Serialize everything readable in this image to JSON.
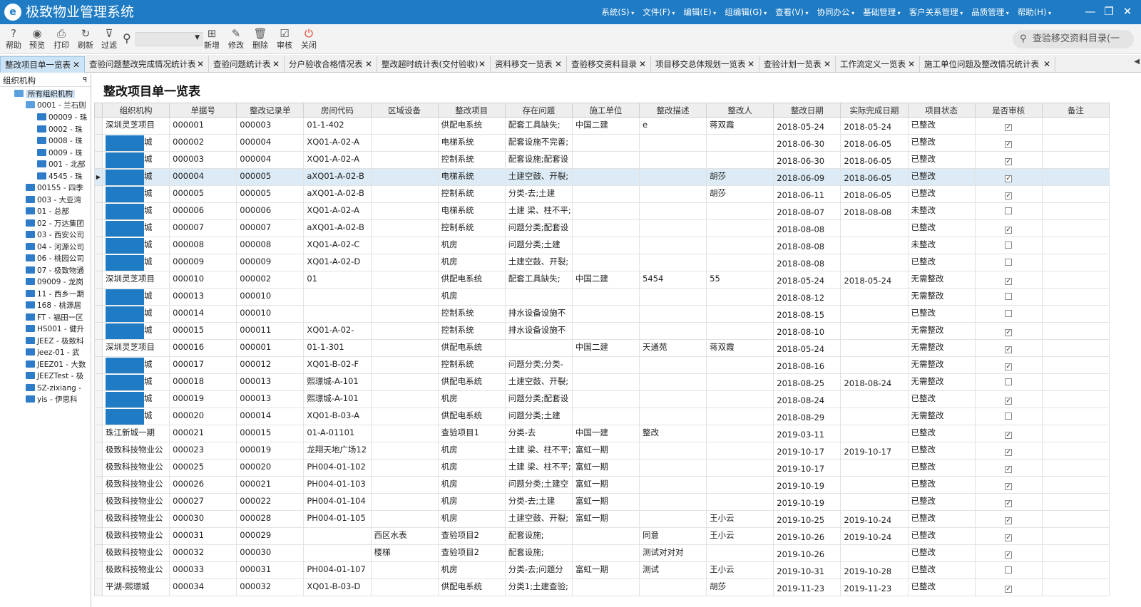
{
  "app": {
    "logo_glyph": "e",
    "title": "极致物业管理系统",
    "menu": [
      "系统(S)",
      "文件(F)",
      "编辑(E)",
      "组编辑(G)",
      "查看(V)",
      "协同办公",
      "基础管理",
      "客户关系管理",
      "品质管理",
      "帮助(H)"
    ],
    "window_controls": [
      "—",
      "❐",
      "✕"
    ]
  },
  "toolbar": {
    "buttons": [
      {
        "label": "帮助",
        "icon": "?"
      },
      {
        "label": "预览",
        "icon": "◉"
      },
      {
        "label": "打印",
        "icon": "⎙"
      },
      {
        "label": "刷新",
        "icon": "↻"
      },
      {
        "label": "过滤",
        "icon": "⊽"
      },
      {
        "label": "新增",
        "icon": "⊞"
      },
      {
        "label": "修改",
        "icon": "✎"
      },
      {
        "label": "删除",
        "icon": "🗑"
      },
      {
        "label": "审核",
        "icon": "☑"
      },
      {
        "label": "关闭",
        "icon": "⏻"
      }
    ],
    "search_icon": "⚲",
    "combo_value": "",
    "right_search_text": "查验移交资料目录(一"
  },
  "tabs": [
    {
      "label": "整改项目单一览表",
      "active": true
    },
    {
      "label": "查验问题整改完成情况统计表"
    },
    {
      "label": "查验问题统计表"
    },
    {
      "label": "分户验收合格情况表"
    },
    {
      "label": "整改超时统计表(交付验收)"
    },
    {
      "label": "资料移交一览表"
    },
    {
      "label": "查验移交资料目录"
    },
    {
      "label": "项目移交总体规划一览表"
    },
    {
      "label": "查验计划一览表"
    },
    {
      "label": "工作流定义一览表"
    },
    {
      "label": "施工单位问题及整改情况统计表"
    }
  ],
  "sidebar": {
    "title": "组织机构",
    "pin": "ꟼ",
    "root": "所有组织机构",
    "child_open": "0001 - 兰石则",
    "sub_items": [
      "00009 - 珠",
      "0002 - 珠",
      "0008 - 珠",
      "0009 - 珠",
      "001 - 北部",
      "4545 - 珠"
    ],
    "items": [
      "00155 - 四季",
      "003 - 大亚湾",
      "01 - 总部",
      "02 - 万达集团",
      "03 - 西安公司",
      "04 - 河源公司",
      "06 - 桃园公司",
      "07 - 极致物通",
      "09009 - 龙岗",
      "11 - 西乡一期",
      "168 - 桃源居",
      "FT - 福田一区",
      "HS001 - 健升",
      "JEEZ - 极致科",
      "jeez-01 - 武",
      "JEEZ01 - 大数",
      "JEEZTest - 极",
      "SZ-zixiang -",
      "yis - 伊思科"
    ]
  },
  "page": {
    "title": "整改项目单一览表"
  },
  "grid": {
    "columns": [
      "组织机构",
      "单据号",
      "整改记录单",
      "房间代码",
      "区域设备",
      "整改项目",
      "存在问题",
      "施工单位",
      "整改描述",
      "整改人",
      "整改日期",
      "实际完成日期",
      "项目状态",
      "是否审核",
      "备注"
    ],
    "selected_row_marker": "▶",
    "check_glyph": "✓",
    "rows": [
      {
        "org": "深圳灵芝项目",
        "doc": "000001",
        "rec": "000003",
        "room": "01-1-402",
        "area": "",
        "item": "供配电系统",
        "problem": "配套工具缺失;",
        "contractor": "中国二建",
        "desc": "e",
        "person": "蒋双霞",
        "date": "2018-05-24",
        "done": "2018-05-24",
        "status": "已整改",
        "audited": true,
        "note": ""
      },
      {
        "org": "城",
        "redact": true,
        "doc": "000002",
        "rec": "000004",
        "room": "XQ01-A-02-A",
        "area": "",
        "item": "电梯系统",
        "problem": "配套设施不完善;",
        "contractor": "",
        "desc": "",
        "person": "",
        "date": "2018-06-30",
        "done": "2018-06-05",
        "status": "已整改",
        "audited": true,
        "note": ""
      },
      {
        "org": "城",
        "redact": true,
        "doc": "000003",
        "rec": "000004",
        "room": "XQ01-A-02-A",
        "area": "",
        "item": "控制系统",
        "problem": "配套设施;配套设",
        "contractor": "",
        "desc": "",
        "person": "",
        "date": "2018-06-30",
        "done": "2018-06-05",
        "status": "已整改",
        "audited": true,
        "note": ""
      },
      {
        "org": "城",
        "redact": true,
        "doc": "000004",
        "rec": "000005",
        "room": "aXQ01-A-02-B",
        "area": "",
        "item": "电梯系统",
        "problem": "土建空鼓、开裂;",
        "contractor": "",
        "desc": "",
        "person": "胡莎",
        "date": "2018-06-09",
        "done": "2018-06-05",
        "status": "已整改",
        "audited": true,
        "note": "",
        "selected": true
      },
      {
        "org": "城",
        "redact": true,
        "doc": "000005",
        "rec": "000005",
        "room": "aXQ01-A-02-B",
        "area": "",
        "item": "控制系统",
        "problem": "分类-去;土建",
        "contractor": "",
        "desc": "",
        "person": "胡莎",
        "date": "2018-06-11",
        "done": "2018-06-05",
        "status": "已整改",
        "audited": true,
        "note": ""
      },
      {
        "org": "城",
        "redact": true,
        "doc": "000006",
        "rec": "000006",
        "room": "XQ01-A-02-A",
        "area": "",
        "item": "电梯系统",
        "problem": "土建 梁、柱不平;",
        "contractor": "",
        "desc": "",
        "person": "",
        "date": "2018-08-07",
        "done": "2018-08-08",
        "status": "未整改",
        "audited": false,
        "note": ""
      },
      {
        "org": "城",
        "redact": true,
        "doc": "000007",
        "rec": "000007",
        "room": "aXQ01-A-02-B",
        "area": "",
        "item": "控制系统",
        "problem": "问题分类;配套设",
        "contractor": "",
        "desc": "",
        "person": "",
        "date": "2018-08-08",
        "done": "",
        "status": "已整改",
        "audited": true,
        "note": ""
      },
      {
        "org": "城",
        "redact": true,
        "doc": "000008",
        "rec": "000008",
        "room": "XQ01-A-02-C",
        "area": "",
        "item": "机房",
        "problem": "问题分类;土建",
        "contractor": "",
        "desc": "",
        "person": "",
        "date": "2018-08-08",
        "done": "",
        "status": "未整改",
        "audited": false,
        "note": ""
      },
      {
        "org": "城",
        "redact": true,
        "doc": "000009",
        "rec": "000009",
        "room": "XQ01-A-02-D",
        "area": "",
        "item": "机房",
        "problem": "土建空鼓、开裂;",
        "contractor": "",
        "desc": "",
        "person": "",
        "date": "2018-08-08",
        "done": "",
        "status": "已整改",
        "audited": false,
        "note": ""
      },
      {
        "org": "深圳灵芝项目",
        "doc": "000010",
        "rec": "000002",
        "room": "01",
        "area": "",
        "item": "供配电系统",
        "problem": "配套工具缺失;",
        "contractor": "中国二建",
        "desc": "5454",
        "person": "55",
        "date": "2018-05-24",
        "done": "2018-05-24",
        "status": "无需整改",
        "audited": true,
        "note": ""
      },
      {
        "org": "城",
        "redact": true,
        "doc": "000013",
        "rec": "000010",
        "room": "",
        "area": "",
        "item": "机房",
        "problem": "",
        "contractor": "",
        "desc": "",
        "person": "",
        "date": "2018-08-12",
        "done": "",
        "status": "无需整改",
        "audited": false,
        "note": ""
      },
      {
        "org": "城",
        "redact": true,
        "doc": "000014",
        "rec": "000010",
        "room": "",
        "area": "",
        "item": "控制系统",
        "problem": "排水设备设施不",
        "contractor": "",
        "desc": "",
        "person": "",
        "date": "2018-08-15",
        "done": "",
        "status": "已整改",
        "audited": false,
        "note": ""
      },
      {
        "org": "城",
        "redact": true,
        "doc": "000015",
        "rec": "000011",
        "room": "XQ01-A-02-",
        "area": "",
        "item": "控制系统",
        "problem": "排水设备设施不",
        "contractor": "",
        "desc": "",
        "person": "",
        "date": "2018-08-10",
        "done": "",
        "status": "无需整改",
        "audited": true,
        "note": ""
      },
      {
        "org": "深圳灵芝项目",
        "doc": "000016",
        "rec": "000001",
        "room": "01-1-301",
        "area": "",
        "item": "供配电系统",
        "problem": "",
        "contractor": "中国二建",
        "desc": "天通苑",
        "person": "蒋双霞",
        "date": "2018-05-24",
        "done": "",
        "status": "无需整改",
        "audited": true,
        "note": ""
      },
      {
        "org": "城",
        "redact": true,
        "doc": "000017",
        "rec": "000012",
        "room": "XQ01-B-02-F",
        "area": "",
        "item": "控制系统",
        "problem": "问题分类;分类-",
        "contractor": "",
        "desc": "",
        "person": "",
        "date": "2018-08-16",
        "done": "",
        "status": "无需整改",
        "audited": true,
        "note": ""
      },
      {
        "org": "城",
        "redact": true,
        "doc": "000018",
        "rec": "000013",
        "room": "熙璟城-A-101",
        "area": "",
        "item": "供配电系统",
        "problem": "土建空鼓、开裂;",
        "contractor": "",
        "desc": "",
        "person": "",
        "date": "2018-08-25",
        "done": "2018-08-24",
        "status": "无需整改",
        "audited": false,
        "note": ""
      },
      {
        "org": "城",
        "redact": true,
        "doc": "000019",
        "rec": "000013",
        "room": "熙璟城-A-101",
        "area": "",
        "item": "机房",
        "problem": "问题分类;配套设",
        "contractor": "",
        "desc": "",
        "person": "",
        "date": "2018-08-24",
        "done": "",
        "status": "已整改",
        "audited": true,
        "note": ""
      },
      {
        "org": "城",
        "redact": true,
        "doc": "000020",
        "rec": "000014",
        "room": "XQ01-B-03-A",
        "area": "",
        "item": "供配电系统",
        "problem": "问题分类;土建",
        "contractor": "",
        "desc": "",
        "person": "",
        "date": "2018-08-29",
        "done": "",
        "status": "无需整改",
        "audited": false,
        "note": ""
      },
      {
        "org": "珠江新城一期",
        "doc": "000021",
        "rec": "000015",
        "room": "01-A-01101",
        "area": "",
        "item": "查验项目1",
        "problem": "分类-去",
        "contractor": "中国一建",
        "desc": "整改",
        "person": "",
        "date": "2019-03-11",
        "done": "",
        "status": "已整改",
        "audited": true,
        "note": ""
      },
      {
        "org": "极致科技物业公",
        "doc": "000023",
        "rec": "000019",
        "room": "龙翔天地广场12",
        "area": "",
        "item": "机房",
        "problem": "土建 梁、柱不平;",
        "contractor": "富虹一期",
        "desc": "",
        "person": "",
        "date": "2019-10-17",
        "done": "2019-10-17",
        "status": "已整改",
        "audited": true,
        "note": ""
      },
      {
        "org": "极致科技物业公",
        "doc": "000025",
        "rec": "000020",
        "room": "PH004-01-102",
        "area": "",
        "item": "机房",
        "problem": "土建 梁、柱不平;",
        "contractor": "富虹一期",
        "desc": "",
        "person": "",
        "date": "2019-10-17",
        "done": "",
        "status": "已整改",
        "audited": true,
        "note": ""
      },
      {
        "org": "极致科技物业公",
        "doc": "000026",
        "rec": "000021",
        "room": "PH004-01-103",
        "area": "",
        "item": "机房",
        "problem": "问题分类;土建空",
        "contractor": "富虹一期",
        "desc": "",
        "person": "",
        "date": "2019-10-19",
        "done": "",
        "status": "已整改",
        "audited": true,
        "note": ""
      },
      {
        "org": "极致科技物业公",
        "doc": "000027",
        "rec": "000022",
        "room": "PH004-01-104",
        "area": "",
        "item": "机房",
        "problem": "分类-去;土建",
        "contractor": "富虹一期",
        "desc": "",
        "person": "",
        "date": "2019-10-19",
        "done": "",
        "status": "已整改",
        "audited": true,
        "note": ""
      },
      {
        "org": "极致科技物业公",
        "doc": "000030",
        "rec": "000028",
        "room": "PH004-01-105",
        "area": "",
        "item": "机房",
        "problem": "土建空鼓、开裂;",
        "contractor": "富虹一期",
        "desc": "",
        "person": "王小云",
        "date": "2019-10-25",
        "done": "2019-10-24",
        "status": "已整改",
        "audited": true,
        "note": ""
      },
      {
        "org": "极致科技物业公",
        "doc": "000031",
        "rec": "000029",
        "room": "",
        "area": "西区水表",
        "item": "查验项目2",
        "problem": "配套设施;",
        "contractor": "",
        "desc": "同意",
        "person": "王小云",
        "date": "2019-10-26",
        "done": "2019-10-24",
        "status": "已整改",
        "audited": true,
        "note": ""
      },
      {
        "org": "极致科技物业公",
        "doc": "000032",
        "rec": "000030",
        "room": "",
        "area": "楼梯",
        "item": "查验项目2",
        "problem": "配套设施;",
        "contractor": "",
        "desc": "测试对对对",
        "person": "",
        "date": "2019-10-26",
        "done": "",
        "status": "已整改",
        "audited": true,
        "note": ""
      },
      {
        "org": "极致科技物业公",
        "doc": "000033",
        "rec": "000031",
        "room": "PH004-01-107",
        "area": "",
        "item": "机房",
        "problem": "分类-去;问题分",
        "contractor": "富虹一期",
        "desc": "测试",
        "person": "王小云",
        "date": "2019-10-31",
        "done": "2019-10-28",
        "status": "已整改",
        "audited": false,
        "note": ""
      },
      {
        "org": "平湖-熙璟城",
        "doc": "000034",
        "rec": "000032",
        "room": "XQ01-B-03-D",
        "area": "",
        "item": "供配电系统",
        "problem": "分类1;土建查验;",
        "contractor": "",
        "desc": "",
        "person": "胡莎",
        "date": "2019-11-23",
        "done": "2019-11-23",
        "status": "已整改",
        "audited": true,
        "note": ""
      }
    ]
  }
}
